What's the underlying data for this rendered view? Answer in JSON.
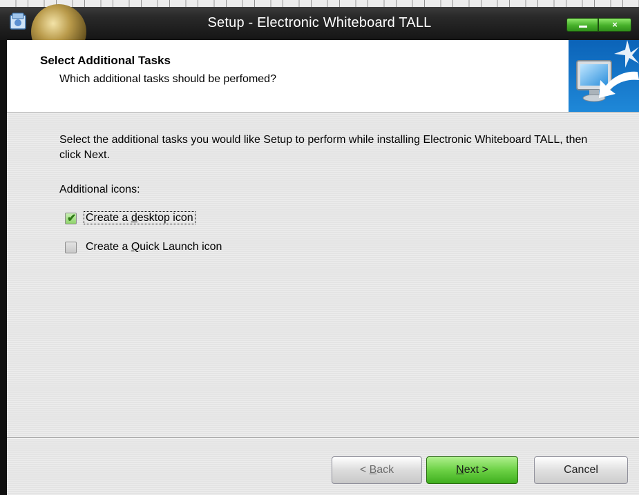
{
  "window": {
    "title": "Setup - Electronic Whiteboard TALL",
    "close_glyph": "×"
  },
  "header": {
    "title": "Select Additional Tasks",
    "subtitle": "Which additional tasks should be perfomed?"
  },
  "content": {
    "intro": "Select the additional tasks you would like Setup to perform while installing Electronic Whiteboard TALL, then click Next.",
    "icons_label": "Additional icons:",
    "options": [
      {
        "label_pre": "Create a ",
        "label_accel": "d",
        "label_post": "esktop icon",
        "checked": true
      },
      {
        "label_pre": "Create a ",
        "label_accel": "Q",
        "label_post": "uick Launch icon",
        "checked": false
      }
    ],
    "check_glyph": "✔"
  },
  "buttons": {
    "back": {
      "pre": "< ",
      "accel": "B",
      "post": "ack"
    },
    "next": {
      "pre": "",
      "accel": "N",
      "post": "ext >"
    },
    "cancel": {
      "label": "Cancel"
    }
  },
  "colors": {
    "title_bar": "#1a1a1a",
    "next_button": "#6cd145",
    "body_bg": "#e8e8e8"
  },
  "icons": [
    "setup-app-icon",
    "computer-arrow-icon",
    "minimize-icon",
    "close-icon",
    "checkbox-checked-icon",
    "checkbox-unchecked-icon"
  ]
}
